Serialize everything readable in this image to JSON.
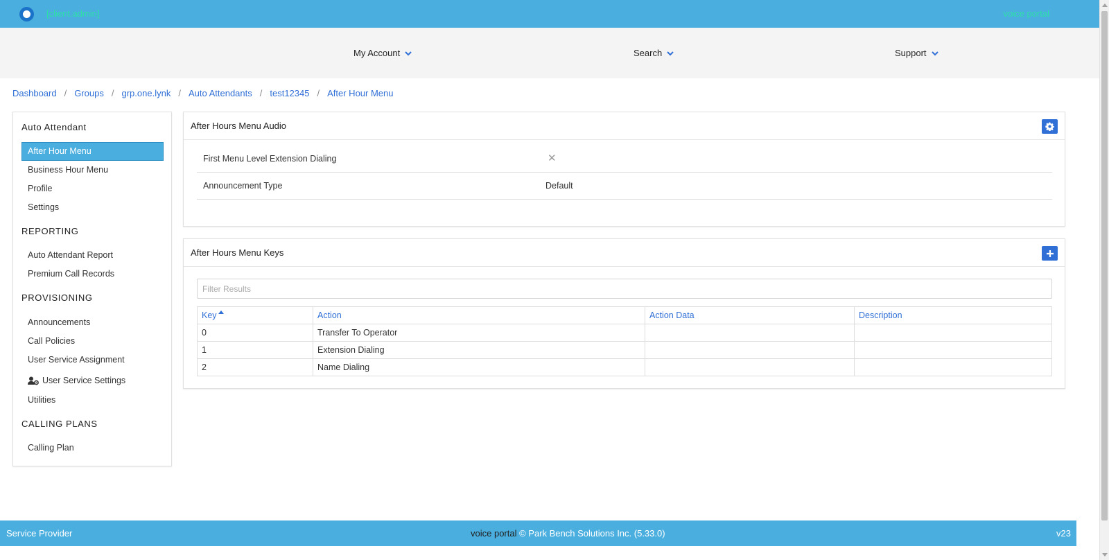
{
  "header": {
    "user_label": "[client.admin]",
    "portal_label": "voice portal"
  },
  "nav": {
    "items": [
      {
        "label": "My Account"
      },
      {
        "label": "Search"
      },
      {
        "label": "Support"
      }
    ]
  },
  "breadcrumb": [
    "Dashboard",
    "Groups",
    "grp.one.lynk",
    "Auto Attendants",
    "test12345",
    "After Hour Menu"
  ],
  "sidebar": {
    "sections": [
      {
        "title": "Auto Attendant",
        "items": [
          "After Hour Menu",
          "Business Hour Menu",
          "Profile",
          "Settings"
        ]
      },
      {
        "title": "REPORTING",
        "items": [
          "Auto Attendant Report",
          "Premium Call Records"
        ]
      },
      {
        "title": "PROVISIONING",
        "items": [
          "Announcements",
          "Call Policies",
          "User Service Assignment",
          "User Service Settings",
          "Utilities"
        ]
      },
      {
        "title": "CALLING PLANS",
        "items": [
          "Calling Plan"
        ]
      }
    ],
    "active_item": "After Hour Menu"
  },
  "audio_panel": {
    "title": "After Hours Menu Audio",
    "rows": [
      {
        "label": "First Menu Level Extension Dialing",
        "value": "✕"
      },
      {
        "label": "Announcement Type",
        "value": "Default"
      }
    ]
  },
  "keys_panel": {
    "title": "After Hours Menu Keys",
    "filter_placeholder": "Filter Results",
    "columns": [
      "Key",
      "Action",
      "Action Data",
      "Description"
    ],
    "rows": [
      {
        "key": "0",
        "action": "Transfer To Operator",
        "action_data": "",
        "description": ""
      },
      {
        "key": "1",
        "action": "Extension Dialing",
        "action_data": "",
        "description": ""
      },
      {
        "key": "2",
        "action": "Name Dialing",
        "action_data": "",
        "description": ""
      }
    ]
  },
  "footer": {
    "left": "Service Provider",
    "center_prefix": "voice portal",
    "center_rest": " © Park Bench Solutions Inc. (5.33.0)",
    "right": "v23"
  },
  "colors": {
    "brand_blue": "#4aaedf",
    "accent_blue": "#2f6fd6",
    "header_user_green": "#2ee0a8"
  }
}
